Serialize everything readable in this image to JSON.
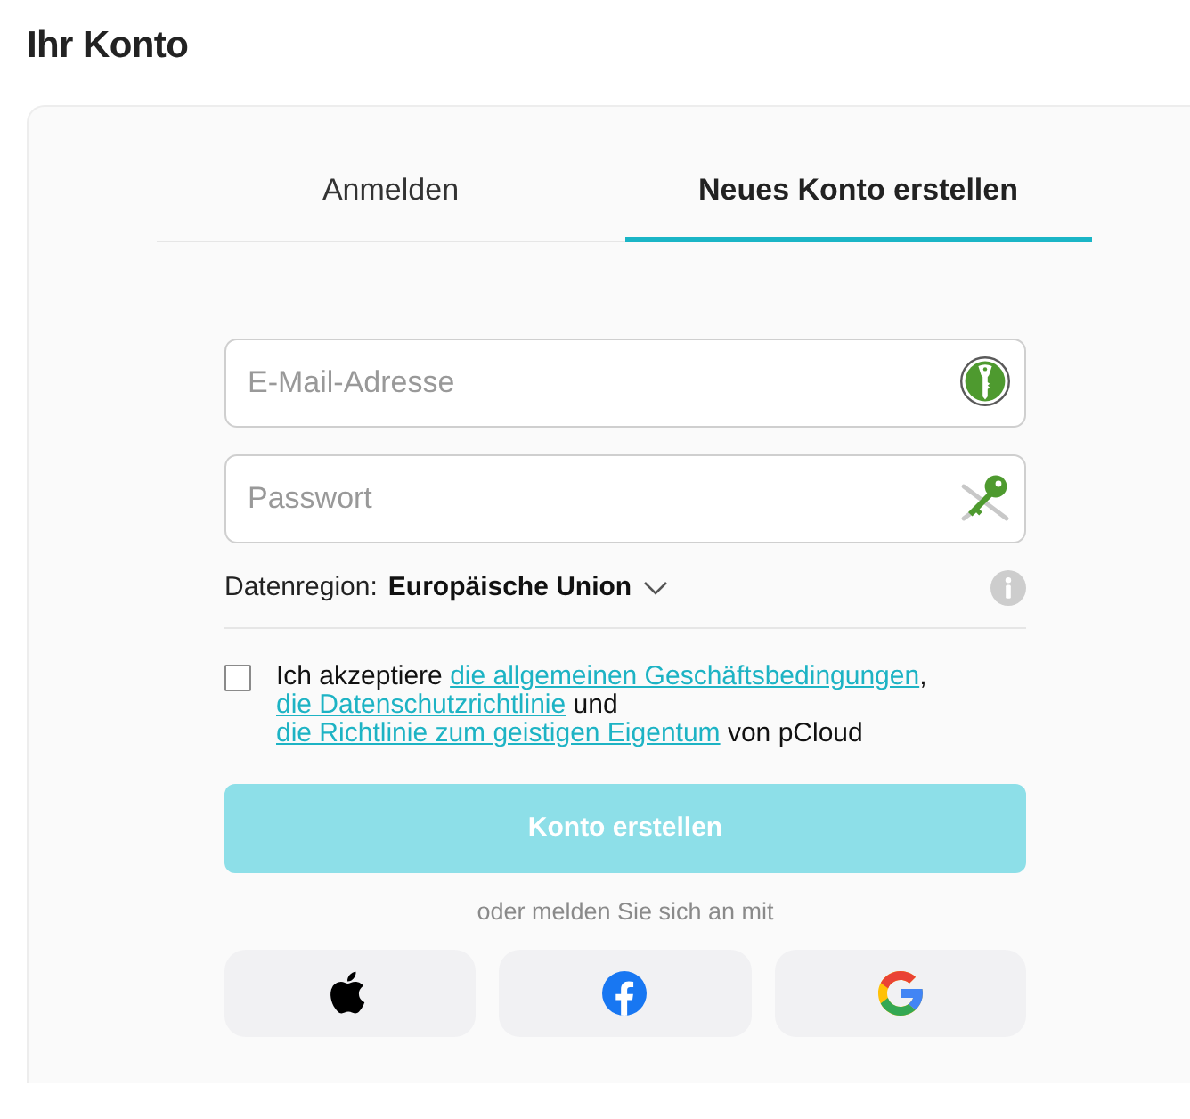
{
  "page_title": "Ihr Konto",
  "tabs": [
    {
      "label": "Anmelden",
      "selected": false
    },
    {
      "label": "Neues Konto erstellen",
      "selected": true
    }
  ],
  "form": {
    "email_field": {
      "placeholder": "E-Mail-Adresse"
    },
    "password_field": {
      "placeholder": "Passwort"
    },
    "data_region": {
      "label": "Datenregion:",
      "value": "Europäische Union"
    },
    "terms": {
      "checked": false,
      "parts": [
        {
          "kind": "text",
          "text": "Ich akzeptiere "
        },
        {
          "kind": "link",
          "text": "die allgemeinen Geschäftsbedingungen"
        },
        {
          "kind": "text",
          "text": ", "
        },
        {
          "kind": "link",
          "text": "die Datenschutzrichtlinie"
        },
        {
          "kind": "text",
          "text": " und "
        },
        {
          "kind": "link",
          "text": "die Richtlinie zum geistigen Eigentum"
        },
        {
          "kind": "text",
          "text": " von pCloud"
        }
      ]
    },
    "submit_button": {
      "label": "Konto erstellen",
      "disabled": true
    },
    "alternative_login_text": "oder melden Sie sich an mit",
    "social_buttons": [
      {
        "kind": "apple"
      },
      {
        "kind": "facebook"
      },
      {
        "kind": "google"
      }
    ]
  }
}
